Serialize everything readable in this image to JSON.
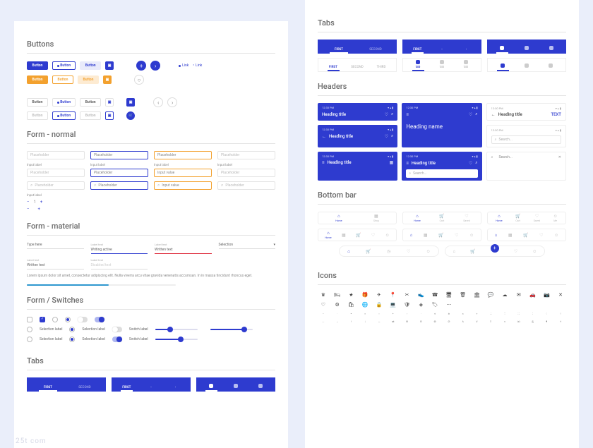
{
  "colors": {
    "primary": "#2e3bcf",
    "accent": "#f3a12e",
    "bg": "#eaeefa"
  },
  "sections": {
    "buttons": "Buttons",
    "form_normal": "Form - normal",
    "form_material": "Form - material",
    "switches": "Form / Switches",
    "tabs": "Tabs",
    "headers": "Headers",
    "bottom_bar": "Bottom bar",
    "icons": "Icons"
  },
  "buttons": {
    "label": "Button",
    "link": "Link",
    "plus": "+",
    "arrow": "›"
  },
  "form": {
    "placeholder": "Placeholder",
    "input_label": "Input label",
    "input_value": "Input value",
    "stepper_value": "1"
  },
  "material": {
    "type_here": "Type here",
    "label_text": "Label text",
    "writing_active": "Writing active",
    "written_text": "Written text",
    "selection": "Selection",
    "disabled_text": "Disabled text",
    "lorem": "Lorem ipsum dolor sit amet, consectetur adipiscing elit. Nulla viverra arcu vitae gravida venenatis accumsan. In in massa tincidunt rhoncus eget."
  },
  "switches": {
    "selection_label": "Selection label",
    "switch_label": "Switch label"
  },
  "tabs": {
    "first": "FIRST",
    "second": "SECOND",
    "third": "THIRD"
  },
  "headers": {
    "time": "12:30 PM",
    "heading_title": "Heading title",
    "heading_name": "Heading name",
    "text_action": "TEXT",
    "search_placeholder": "Search..."
  },
  "bottom_bar": {
    "items": [
      "Home",
      "Shop",
      "Cart",
      "Saved",
      "Me"
    ]
  },
  "watermark": "25t  com"
}
